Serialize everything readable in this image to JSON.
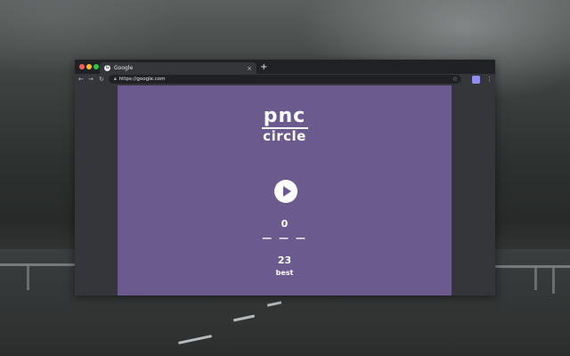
{
  "browser": {
    "tab_title": "Google",
    "new_tab_symbol": "+",
    "close_symbol": "×",
    "url": "https://google.com",
    "extension_label": "",
    "window_controls": [
      "#ff5f57",
      "#febc2e",
      "#28c840"
    ]
  },
  "game": {
    "logo_top": "pnc",
    "logo_bottom": "circle",
    "score": "0",
    "dashes": "— — —",
    "best_value": "23",
    "best_label": "best",
    "background": "#6a5a8e"
  }
}
